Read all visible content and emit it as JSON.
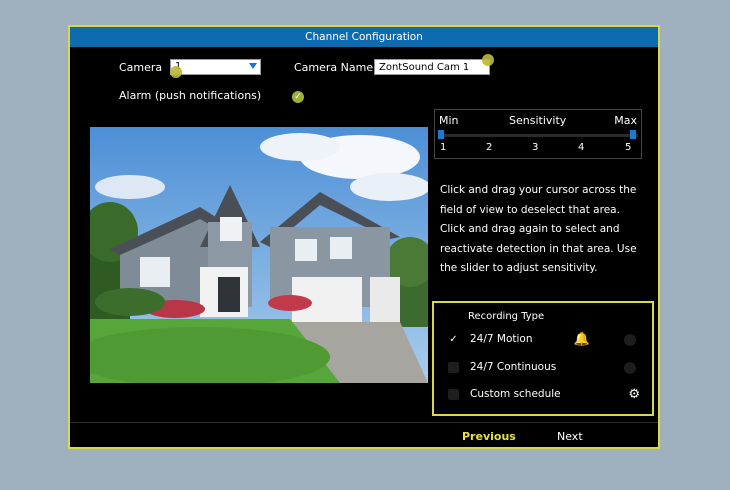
{
  "window": {
    "title": "Channel Configuration"
  },
  "camera": {
    "label": "Camera",
    "selected": "1"
  },
  "camera_name": {
    "label": "Camera Name",
    "value": "ZontSound Cam 1"
  },
  "alarm": {
    "label": "Alarm (push notifications)",
    "checked": true,
    "check_glyph": "✓"
  },
  "sensitivity": {
    "label": "Sensitivity",
    "min_label": "Min",
    "max_label": "Max",
    "ticks": [
      "1",
      "2",
      "3",
      "4",
      "5"
    ],
    "value": 1
  },
  "help_text": "Click and drag your cursor across the field of view to deselect that area. Click and drag again to select and reactivate detection in that area. Use the slider to adjust sensitivity.",
  "recording": {
    "title": "Recording Type",
    "options": [
      {
        "label": "24/7 Motion",
        "checked": true,
        "check_glyph": "✓",
        "icon": "bell-icon",
        "icon_glyph": "🔔"
      },
      {
        "label": "24/7 Continuous",
        "checked": false
      },
      {
        "label": "Custom schedule",
        "checked": false,
        "icon": "gear-icon",
        "icon_glyph": "⚙"
      }
    ]
  },
  "nav": {
    "previous": "Previous",
    "next": "Next"
  },
  "colors": {
    "accent": "#d9d84a",
    "title_bar": "#0f6bb0",
    "slider": "#1e7ad0"
  }
}
